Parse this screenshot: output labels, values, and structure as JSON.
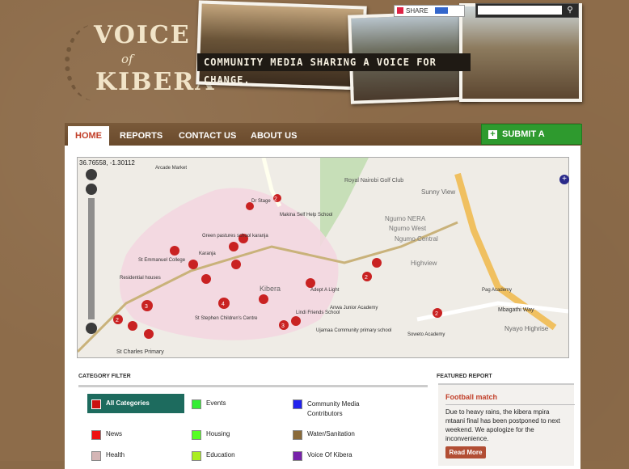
{
  "site": {
    "logo_line1": "VOICE",
    "logo_line2": "of",
    "logo_line3": "KIBERA",
    "banner": "COMMUNITY MEDIA SHARING A VOICE FOR CHANGE."
  },
  "share": {
    "label": "SHARE"
  },
  "search": {
    "placeholder": "",
    "icon": "search-icon"
  },
  "nav": {
    "tabs": [
      {
        "label": "HOME",
        "active": true
      },
      {
        "label": "REPORTS"
      },
      {
        "label": "CONTACT US"
      },
      {
        "label": "ABOUT US"
      }
    ],
    "submit": "SUBMIT A REPORT"
  },
  "map": {
    "coordinates": "36.76558, -1.30112",
    "labels": [
      {
        "t": "Royal Nairobi Golf Club"
      },
      {
        "t": "Sunny View"
      },
      {
        "t": "Ngumo NERA"
      },
      {
        "t": "Ngumo West"
      },
      {
        "t": "Ngumo Central"
      },
      {
        "t": "Highview"
      },
      {
        "t": "Kibera"
      },
      {
        "t": "Nyayo Highrise"
      },
      {
        "t": "Mbagathi Way"
      },
      {
        "t": "St Charles Primary"
      },
      {
        "t": "Makina Self Help School"
      },
      {
        "t": "Adept A Light"
      },
      {
        "t": "Anwa Junior Academy"
      },
      {
        "t": "Ujamaa Community primary school"
      },
      {
        "t": "Karanja"
      },
      {
        "t": "St Emmanuel College"
      },
      {
        "t": "Green pastures school karanja"
      },
      {
        "t": "Residential houses"
      },
      {
        "t": "Pag Academy"
      },
      {
        "t": "Arcade Market"
      },
      {
        "t": "Dr Stage"
      },
      {
        "t": "Lindi Friends School"
      },
      {
        "t": "Soweto Academy"
      },
      {
        "t": "St Stephen Children's Centre"
      }
    ],
    "clusters": [
      {
        "count": "2"
      },
      {
        "count": "3"
      },
      {
        "count": "4"
      },
      {
        "count": "3"
      },
      {
        "count": "2"
      },
      {
        "count": "2"
      },
      {
        "count": "2"
      }
    ]
  },
  "category_filter": {
    "title": "CATEGORY FILTER",
    "items": [
      {
        "label": "All Categories",
        "color": "#cc1111"
      },
      {
        "label": "Events",
        "color": "#33ee33"
      },
      {
        "label": "Community Media Contributors",
        "color": "#2222ee"
      },
      {
        "label": "News",
        "color": "#ee1111"
      },
      {
        "label": "Housing",
        "color": "#55ff22"
      },
      {
        "label": "Water/Sanitation",
        "color": "#8a6a3a"
      },
      {
        "label": "Health",
        "color": "#d4b6b6"
      },
      {
        "label": "Education",
        "color": "#aaee22"
      },
      {
        "label": "Voice Of Kibera",
        "color": "#7722aa"
      }
    ]
  },
  "featured_report": {
    "section_title": "FEATURED REPORT",
    "title": "Football match",
    "body": "Due to heavy rains, the kibera mpira mtaani final has been postponed to next weekend. We apologize for the inconvenience.",
    "read_more": "Read More"
  }
}
